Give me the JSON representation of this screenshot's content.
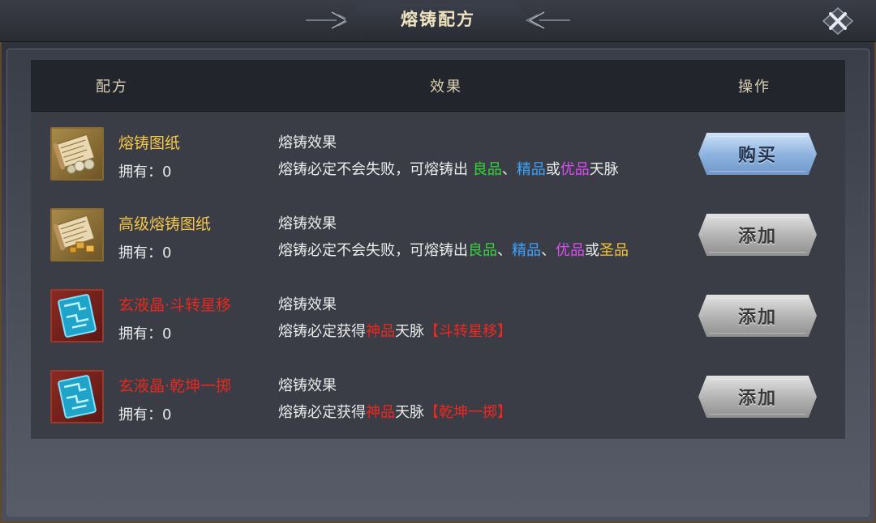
{
  "window": {
    "title": "熔铸配方"
  },
  "table": {
    "headers": {
      "recipe": "配方",
      "effect": "效果",
      "action": "操作"
    },
    "rows": [
      {
        "name": "熔铸图纸",
        "name_color": "gold",
        "icon": "scroll-with-pearls-icon",
        "owned_label": "拥有：",
        "owned": "0",
        "effect_title": "熔铸效果",
        "effect_desc": [
          {
            "t": "熔铸必定不会失败，可熔铸出 ",
            "c": ""
          },
          {
            "t": "良品",
            "c": "green"
          },
          {
            "t": "、",
            "c": ""
          },
          {
            "t": "精品",
            "c": "blue"
          },
          {
            "t": "或",
            "c": ""
          },
          {
            "t": "优品",
            "c": "purple"
          },
          {
            "t": "天脉",
            "c": ""
          }
        ],
        "button": "购买",
        "button_style": "blue"
      },
      {
        "name": "高级熔铸图纸",
        "name_color": "gold",
        "icon": "scroll-with-gold-icon",
        "owned_label": "拥有：",
        "owned": "0",
        "effect_title": "熔铸效果",
        "effect_desc": [
          {
            "t": "熔铸必定不会失败，可熔铸出",
            "c": ""
          },
          {
            "t": "良品",
            "c": "green"
          },
          {
            "t": "、",
            "c": ""
          },
          {
            "t": "精品",
            "c": "blue"
          },
          {
            "t": "、",
            "c": ""
          },
          {
            "t": "优品",
            "c": "purple"
          },
          {
            "t": "或",
            "c": ""
          },
          {
            "t": "圣品",
            "c": "gold"
          }
        ],
        "button": "添加",
        "button_style": "gray"
      },
      {
        "name": "玄液晶·斗转星移",
        "name_color": "red",
        "icon": "crystal-card-icon",
        "owned_label": "拥有：",
        "owned": "0",
        "effect_title": "熔铸效果",
        "effect_desc": [
          {
            "t": "熔铸必定获得",
            "c": ""
          },
          {
            "t": "神品",
            "c": "red"
          },
          {
            "t": "天脉",
            "c": ""
          },
          {
            "t": "【斗转星移】",
            "c": "red"
          }
        ],
        "button": "添加",
        "button_style": "gray"
      },
      {
        "name": "玄液晶·乾坤一掷",
        "name_color": "red",
        "icon": "crystal-card-icon",
        "owned_label": "拥有：",
        "owned": "0",
        "effect_title": "熔铸效果",
        "effect_desc": [
          {
            "t": "熔铸必定获得",
            "c": ""
          },
          {
            "t": "神品",
            "c": "red"
          },
          {
            "t": "天脉",
            "c": ""
          },
          {
            "t": "【乾坤一掷】",
            "c": "red"
          }
        ],
        "button": "添加",
        "button_style": "gray"
      }
    ]
  },
  "colors": {
    "quality_good": "#35d63c",
    "quality_fine": "#3aa3ff",
    "quality_excellent": "#dd4cf5",
    "quality_holy": "#f5c33a",
    "quality_divine": "#f0271d",
    "name_gold": "#f3c64a",
    "name_red": "#e8281e"
  }
}
